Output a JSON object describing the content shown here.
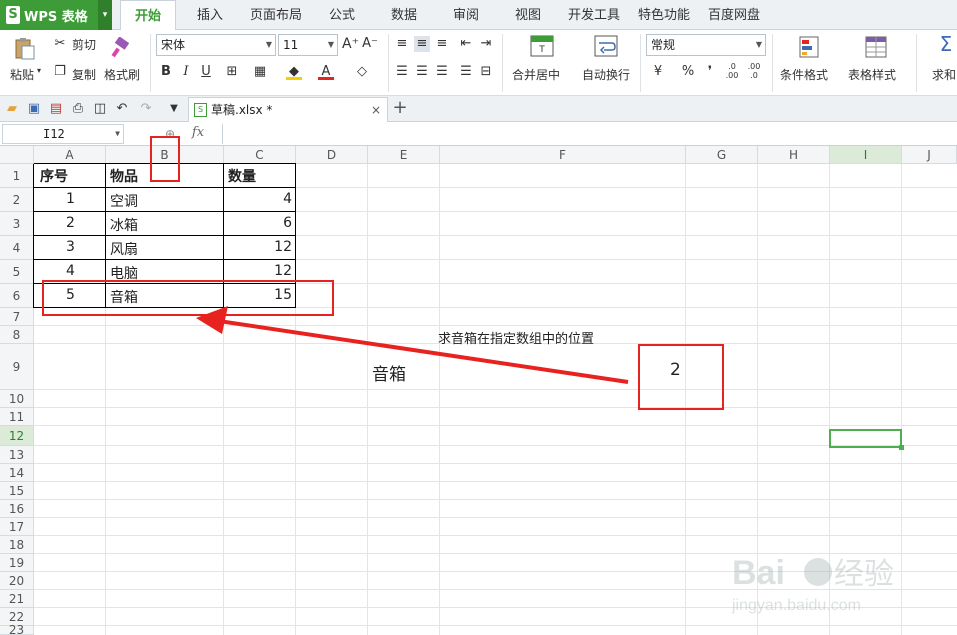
{
  "app": {
    "name": "WPS 表格",
    "logo": "S"
  },
  "menu": {
    "tabs": [
      "开始",
      "插入",
      "页面布局",
      "公式",
      "数据",
      "审阅",
      "视图",
      "开发工具",
      "特色功能",
      "百度网盘"
    ],
    "active": "开始"
  },
  "ribbon": {
    "paste": "粘贴",
    "cut": "剪切",
    "copy": "复制",
    "format_painter": "格式刷",
    "font_name": "宋体",
    "font_size": "11",
    "merge_center": "合并居中",
    "wrap_text": "自动换行",
    "number_format": "常规",
    "conditional_format": "条件格式",
    "table_style": "表格样式",
    "sum": "求和",
    "bold": "B",
    "italic": "I",
    "underline": "U",
    "percent": "%",
    "comma": "❜",
    "dec_inc": ".0\n.00",
    "dec_dec": ".00\n.0"
  },
  "document": {
    "tab_title": "草稿.xlsx *"
  },
  "formula_bar": {
    "cell_ref": "I12",
    "fx": "fx"
  },
  "sheet": {
    "columns": [
      "A",
      "B",
      "C",
      "D",
      "E",
      "F",
      "G",
      "H",
      "I",
      "J"
    ],
    "rows": [
      "1",
      "2",
      "3",
      "4",
      "5",
      "6",
      "7",
      "8",
      "9",
      "10",
      "11",
      "12",
      "13",
      "14",
      "15",
      "16",
      "17",
      "18",
      "19",
      "20",
      "21",
      "22",
      "23"
    ],
    "selected_cell": "I12",
    "table": {
      "headers": [
        "序号",
        "物品",
        "数量"
      ],
      "rows": [
        [
          "1",
          "空调",
          "4"
        ],
        [
          "2",
          "冰箱",
          "6"
        ],
        [
          "3",
          "风扇",
          "12"
        ],
        [
          "4",
          "电脑",
          "12"
        ],
        [
          "5",
          "音箱",
          "15"
        ]
      ]
    },
    "annotation_label": "求音箱在指定数组中的位置",
    "lookup_value": "音箱",
    "result": "2"
  },
  "colors": {
    "accent": "#3d9c38",
    "highlight": "#e8231f"
  }
}
